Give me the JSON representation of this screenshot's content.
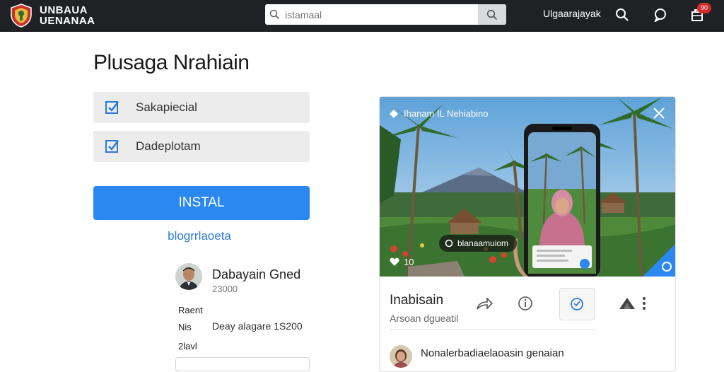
{
  "header": {
    "logo_line1": "UNBAUA",
    "logo_line2": "UENANAA",
    "search": {
      "value": "",
      "placeholder": "istamaal"
    },
    "nav_label": "Ulgaarajayak",
    "cart_badge": "90"
  },
  "main": {
    "title": "Plusaga Nrahiain",
    "options": [
      {
        "label": "Sakapiecial",
        "checked": true
      },
      {
        "label": "Dadeplotam",
        "checked": true
      }
    ],
    "install_label": "INSTAL",
    "secondary_link": "blogrrlaoeta",
    "author": {
      "name": "Dabayain Gned",
      "subtitle": "23000"
    },
    "meta": [
      {
        "key": "Raent"
      },
      {
        "key": "Nis",
        "value": "Deay alagare 1S200"
      },
      {
        "key": "2lavl"
      }
    ]
  },
  "card": {
    "media_caption": "Ihanam IL Nehiabino",
    "media_chip": "blanaamuiom",
    "media_likes": "10",
    "title": "Inabisain",
    "subtitle": "Arsoan dgueatil",
    "comment": "Nonalerbadiaelaoasin genaian"
  },
  "colors": {
    "topbar": "#1f2125",
    "primary": "#2b88f0",
    "link": "#2b7ad8",
    "badge": "#d62a2a",
    "option_bg": "#ececec"
  }
}
